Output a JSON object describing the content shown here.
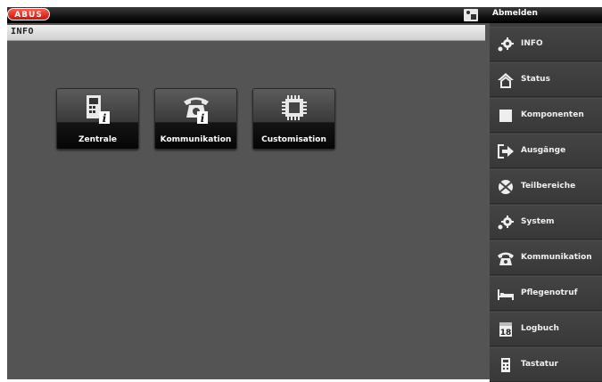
{
  "topbar": {
    "logo": "ABUS",
    "logout_label": "Abmelden"
  },
  "title": "INFO",
  "tiles": [
    {
      "label": "Zentrale",
      "icon": "control-panel-info-icon"
    },
    {
      "label": "Kommunikation",
      "icon": "telephone-info-icon"
    },
    {
      "label": "Customisation",
      "icon": "chip-icon"
    }
  ],
  "sidebar": {
    "items": [
      {
        "label": "INFO",
        "icon": "gears-icon"
      },
      {
        "label": "Status",
        "icon": "house-icon"
      },
      {
        "label": "Komponenten",
        "icon": "square-icon"
      },
      {
        "label": "Ausgänge",
        "icon": "arrow-out-icon"
      },
      {
        "label": "Teilbereiche",
        "icon": "pie-icon"
      },
      {
        "label": "System",
        "icon": "gears-icon"
      },
      {
        "label": "Kommunikation",
        "icon": "telephone-icon"
      },
      {
        "label": "Pflegenotruf",
        "icon": "bed-icon"
      },
      {
        "label": "Logbuch",
        "icon": "calendar-icon"
      },
      {
        "label": "Tastatur",
        "icon": "keypad-icon"
      }
    ],
    "calendar_day": "18"
  },
  "colors": {
    "accent": "#c8160e",
    "background": "#545454",
    "sidebar": "#3d3d3d"
  }
}
